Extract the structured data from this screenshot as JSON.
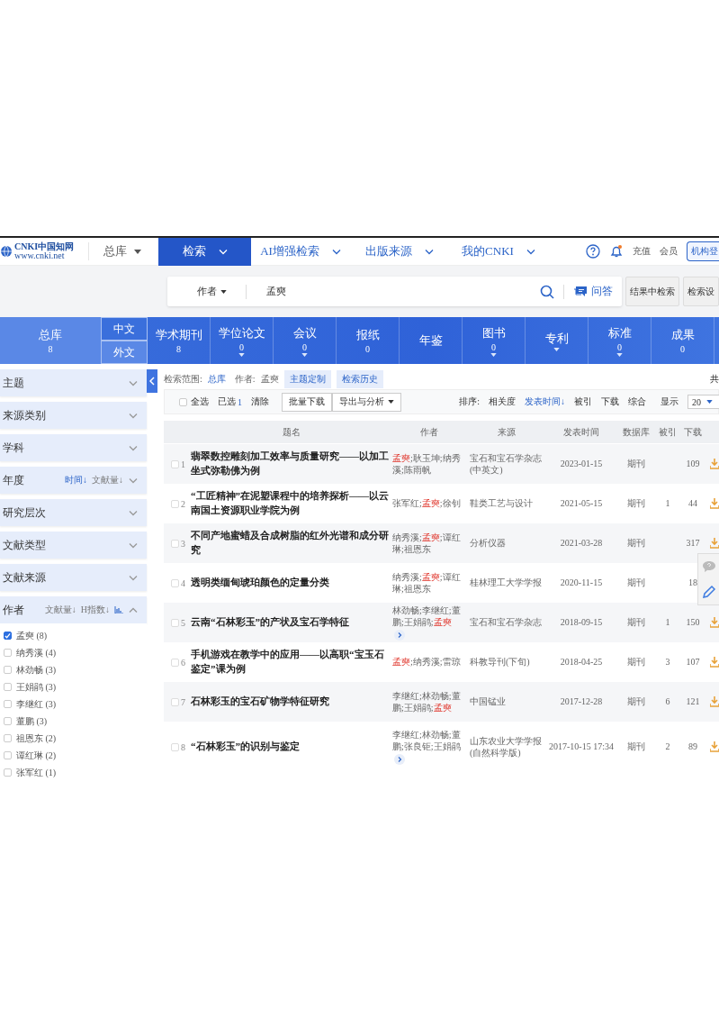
{
  "nav": {
    "logo_text": "CNKI中国知网",
    "logo_url": "www.cnki.net",
    "library": "总库",
    "menus": [
      {
        "label": "检索",
        "selected": true
      },
      {
        "label": "AI增强检索",
        "selected": false
      },
      {
        "label": "出版来源",
        "selected": false
      },
      {
        "label": "我的CNKI",
        "selected": false
      }
    ],
    "links": [
      "充值",
      "会员"
    ],
    "login_button": "机构登"
  },
  "search": {
    "field": "作者",
    "value": "孟奭",
    "qa_button": "问答",
    "buttons": [
      "结果中检索",
      "检索设"
    ]
  },
  "databases": {
    "all": {
      "label": "总库",
      "count": "8",
      "selected": true
    },
    "language_tabs": [
      {
        "label": "中文",
        "selected": true
      },
      {
        "label": "外文",
        "selected": false
      }
    ],
    "items": [
      {
        "label": "学术期刊",
        "count": "8",
        "dropdown": false,
        "selected": false
      },
      {
        "label": "学位论文",
        "count": "0",
        "dropdown": true,
        "selected": false
      },
      {
        "label": "会议",
        "count": "0",
        "dropdown": true,
        "selected": false
      },
      {
        "label": "报纸",
        "count": "0",
        "dropdown": false,
        "selected": false
      },
      {
        "label": "年鉴",
        "dropdown": false,
        "selected": false
      },
      {
        "label": "图书",
        "count": "0",
        "dropdown": true,
        "selected": false
      },
      {
        "label": "专利",
        "dropdown": true,
        "selected": false
      },
      {
        "label": "标准",
        "count": "0",
        "dropdown": true,
        "selected": false
      },
      {
        "label": "成果",
        "count": "0",
        "dropdown": false,
        "selected": false
      }
    ]
  },
  "facets": [
    {
      "label": "主题",
      "expanded": false
    },
    {
      "label": "来源类别",
      "expanded": false
    },
    {
      "label": "学科",
      "expanded": false
    },
    {
      "label": "年度",
      "expanded": false,
      "sorts": [
        {
          "label": "时间↓",
          "selected": true
        },
        {
          "label": "文献量↓",
          "selected": false
        }
      ]
    },
    {
      "label": "研究层次",
      "expanded": false
    },
    {
      "label": "文献类型",
      "expanded": false
    },
    {
      "label": "文献来源",
      "expanded": false
    },
    {
      "label": "作者",
      "expanded": true,
      "sorts": [
        {
          "label": "文献量↓",
          "selected": false
        },
        {
          "label": "H指数↓",
          "selected": false
        }
      ],
      "chart_button": true,
      "options": [
        {
          "label": "孟奭 (8)",
          "checked": true
        },
        {
          "label": "纳秀溪 (4)",
          "checked": false
        },
        {
          "label": "林劲畅 (3)",
          "checked": false
        },
        {
          "label": "王娟鹃 (3)",
          "checked": false
        },
        {
          "label": "李继红 (3)",
          "checked": false
        },
        {
          "label": "董鹏 (3)",
          "checked": false
        },
        {
          "label": "祖恩东 (2)",
          "checked": false
        },
        {
          "label": "谭红琳 (2)",
          "checked": false
        },
        {
          "label": "张军红 (1)",
          "checked": false
        }
      ]
    }
  ],
  "scope": {
    "label": "检索范围:",
    "library": "总库",
    "query_label": "作者:",
    "query": "孟奭",
    "buttons": [
      "主题定制",
      "检索历史"
    ],
    "total": "共"
  },
  "toolbar": {
    "select_all": {
      "label": "全选",
      "checked": false
    },
    "selected_label": "已选",
    "selected_count": "1",
    "clear": "清除",
    "buttons": [
      {
        "label": "批量下载",
        "dropdown": false
      },
      {
        "label": "导出与分析",
        "dropdown": true
      }
    ],
    "sort_label": "排序:",
    "sorts": [
      {
        "label": "相关度",
        "selected": false
      },
      {
        "label": "发表时间↓",
        "selected": true
      },
      {
        "label": "被引",
        "selected": false
      },
      {
        "label": "下载",
        "selected": false
      },
      {
        "label": "综合",
        "selected": false
      }
    ],
    "page_size_label": "显示",
    "page_size": "20"
  },
  "table": {
    "columns": [
      "题名",
      "作者",
      "来源",
      "发表时间",
      "数据库",
      "被引",
      "下载"
    ],
    "rows": [
      {
        "number": "1",
        "checked": false,
        "title": "翡翠数控雕刻加工效率与质量研究——以加工坐式弥勒佛为例",
        "authors": [
          {
            "text": "孟奭",
            "highlighted": true
          },
          {
            "text": ";耿玉坤;纳秀溪;陈雨帆",
            "highlighted": false
          }
        ],
        "more": false,
        "source": "宝石和宝石学杂志(中英文)",
        "date": "2023-01-15",
        "database": "期刊",
        "downloads": "109",
        "download_button": true
      },
      {
        "number": "2",
        "checked": false,
        "title": "“工匠精神”在泥塑课程中的培养探析——以云南国土资源职业学院为例",
        "authors": [
          {
            "text": "张军红;",
            "highlighted": false
          },
          {
            "text": "孟奭",
            "highlighted": true
          },
          {
            "text": ";徐钊",
            "highlighted": false
          }
        ],
        "more": false,
        "source": "鞋类工艺与设计",
        "date": "2021-05-15",
        "database": "期刊",
        "cited": "1",
        "downloads": "44",
        "download_button": true
      },
      {
        "number": "3",
        "checked": false,
        "title": "不同产地蜜蜡及合成树脂的红外光谱和成分研究",
        "authors": [
          {
            "text": "纳秀溪;",
            "highlighted": false
          },
          {
            "text": "孟奭",
            "highlighted": true
          },
          {
            "text": ";谭红琳;祖恩东",
            "highlighted": false
          }
        ],
        "more": false,
        "source": "分析仪器",
        "date": "2021-03-28",
        "database": "期刊",
        "downloads": "317",
        "download_button": true
      },
      {
        "number": "4",
        "checked": false,
        "title": "透明类缅甸琥珀颜色的定量分类",
        "authors": [
          {
            "text": "纳秀溪;",
            "highlighted": false
          },
          {
            "text": "孟奭",
            "highlighted": true
          },
          {
            "text": ";谭红琳;祖恩东",
            "highlighted": false
          }
        ],
        "more": false,
        "source": "桂林理工大学学报",
        "date": "2020-11-15",
        "database": "期刊",
        "downloads": "18",
        "download_button": false
      },
      {
        "number": "5",
        "checked": false,
        "title": "云南“石林彩玉”的产状及宝石学特征",
        "authors": [
          {
            "text": "林劲畅;李继红;董鹏;王娟鹃;",
            "highlighted": false
          },
          {
            "text": "孟奭",
            "highlighted": true
          }
        ],
        "more": true,
        "source": "宝石和宝石学杂志",
        "date": "2018-09-15",
        "database": "期刊",
        "cited": "1",
        "downloads": "150",
        "download_button": true
      },
      {
        "number": "6",
        "checked": false,
        "title": "手机游戏在教学中的应用——以高职“宝玉石鉴定”课为例",
        "authors": [
          {
            "text": "孟奭",
            "highlighted": true
          },
          {
            "text": ";纳秀溪;雷琼",
            "highlighted": false
          }
        ],
        "more": false,
        "source": "科教导刊(下旬)",
        "date": "2018-04-25",
        "database": "期刊",
        "cited": "3",
        "downloads": "107",
        "download_button": true
      },
      {
        "number": "7",
        "checked": false,
        "title": "石林彩玉的宝石矿物学特征研究",
        "authors": [
          {
            "text": "李继红;林劲畅;董鹏;王娟鹃;",
            "highlighted": false
          },
          {
            "text": "孟奭",
            "highlighted": true
          }
        ],
        "more": false,
        "source": "中国锰业",
        "date": "2017-12-28",
        "database": "期刊",
        "cited": "6",
        "downloads": "121",
        "download_button": true
      },
      {
        "number": "8",
        "checked": false,
        "title": "“石林彩玉”的识别与鉴定",
        "authors": [
          {
            "text": "李继红;林劲畅;董鹏;张良钜;王娟鹃",
            "highlighted": false
          }
        ],
        "more": true,
        "source": "山东农业大学学报(自然科学版)",
        "date": "2017-10-15 17:34",
        "database": "期刊",
        "cited": "2",
        "downloads": "89",
        "download_button": true
      }
    ]
  }
}
